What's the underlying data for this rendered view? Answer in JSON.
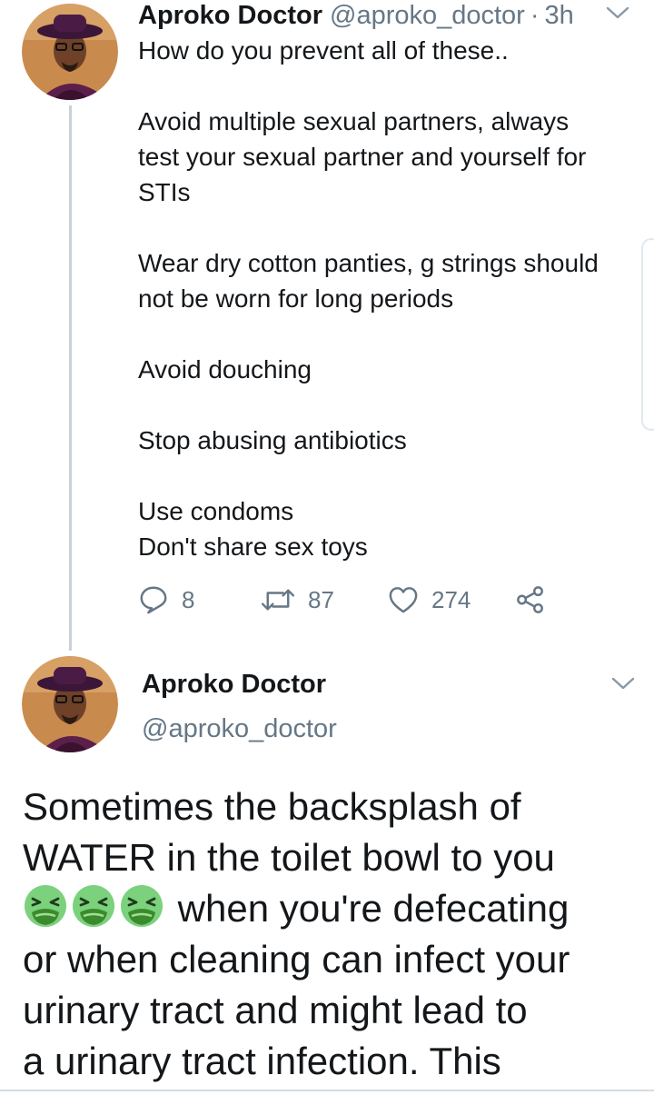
{
  "tweet1": {
    "author_name": "Aproko Doctor",
    "handle": "@aproko_doctor",
    "separator": "·",
    "time": "3h",
    "paragraphs": [
      [
        "How do you prevent all of these.."
      ],
      [
        "Avoid multiple sexual partners, always",
        "test your sexual partner and yourself for",
        "STIs"
      ],
      [
        "Wear dry cotton panties, g strings should",
        "not be worn for long periods"
      ],
      [
        "Avoid douching"
      ],
      [
        "Stop abusing antibiotics"
      ],
      [
        "Use condoms",
        "Don't share sex toys"
      ]
    ],
    "actions": {
      "replies": "8",
      "retweets": "87",
      "likes": "274"
    }
  },
  "tweet2": {
    "author_name": "Aproko Doctor",
    "handle": "@aproko_doctor",
    "body_lines": [
      "Sometimes the backsplash of",
      "WATER in the toilet bowl to you",
      "when you're defecating",
      "or when cleaning can infect your",
      "urinary tract and might lead to",
      "a urinary tract infection. This"
    ],
    "emoji_name": "nauseated-face-emoji"
  },
  "icons": {
    "reply": "reply-icon",
    "retweet": "retweet-icon",
    "like": "heart-icon",
    "share": "share-icon",
    "menu": "chevron-down-icon"
  },
  "colors": {
    "text": "#14171a",
    "secondary": "#657786",
    "thread_line": "#c8d1d9",
    "emoji_face": "#7bd17c",
    "emoji_mouth": "#3c8a2e"
  }
}
